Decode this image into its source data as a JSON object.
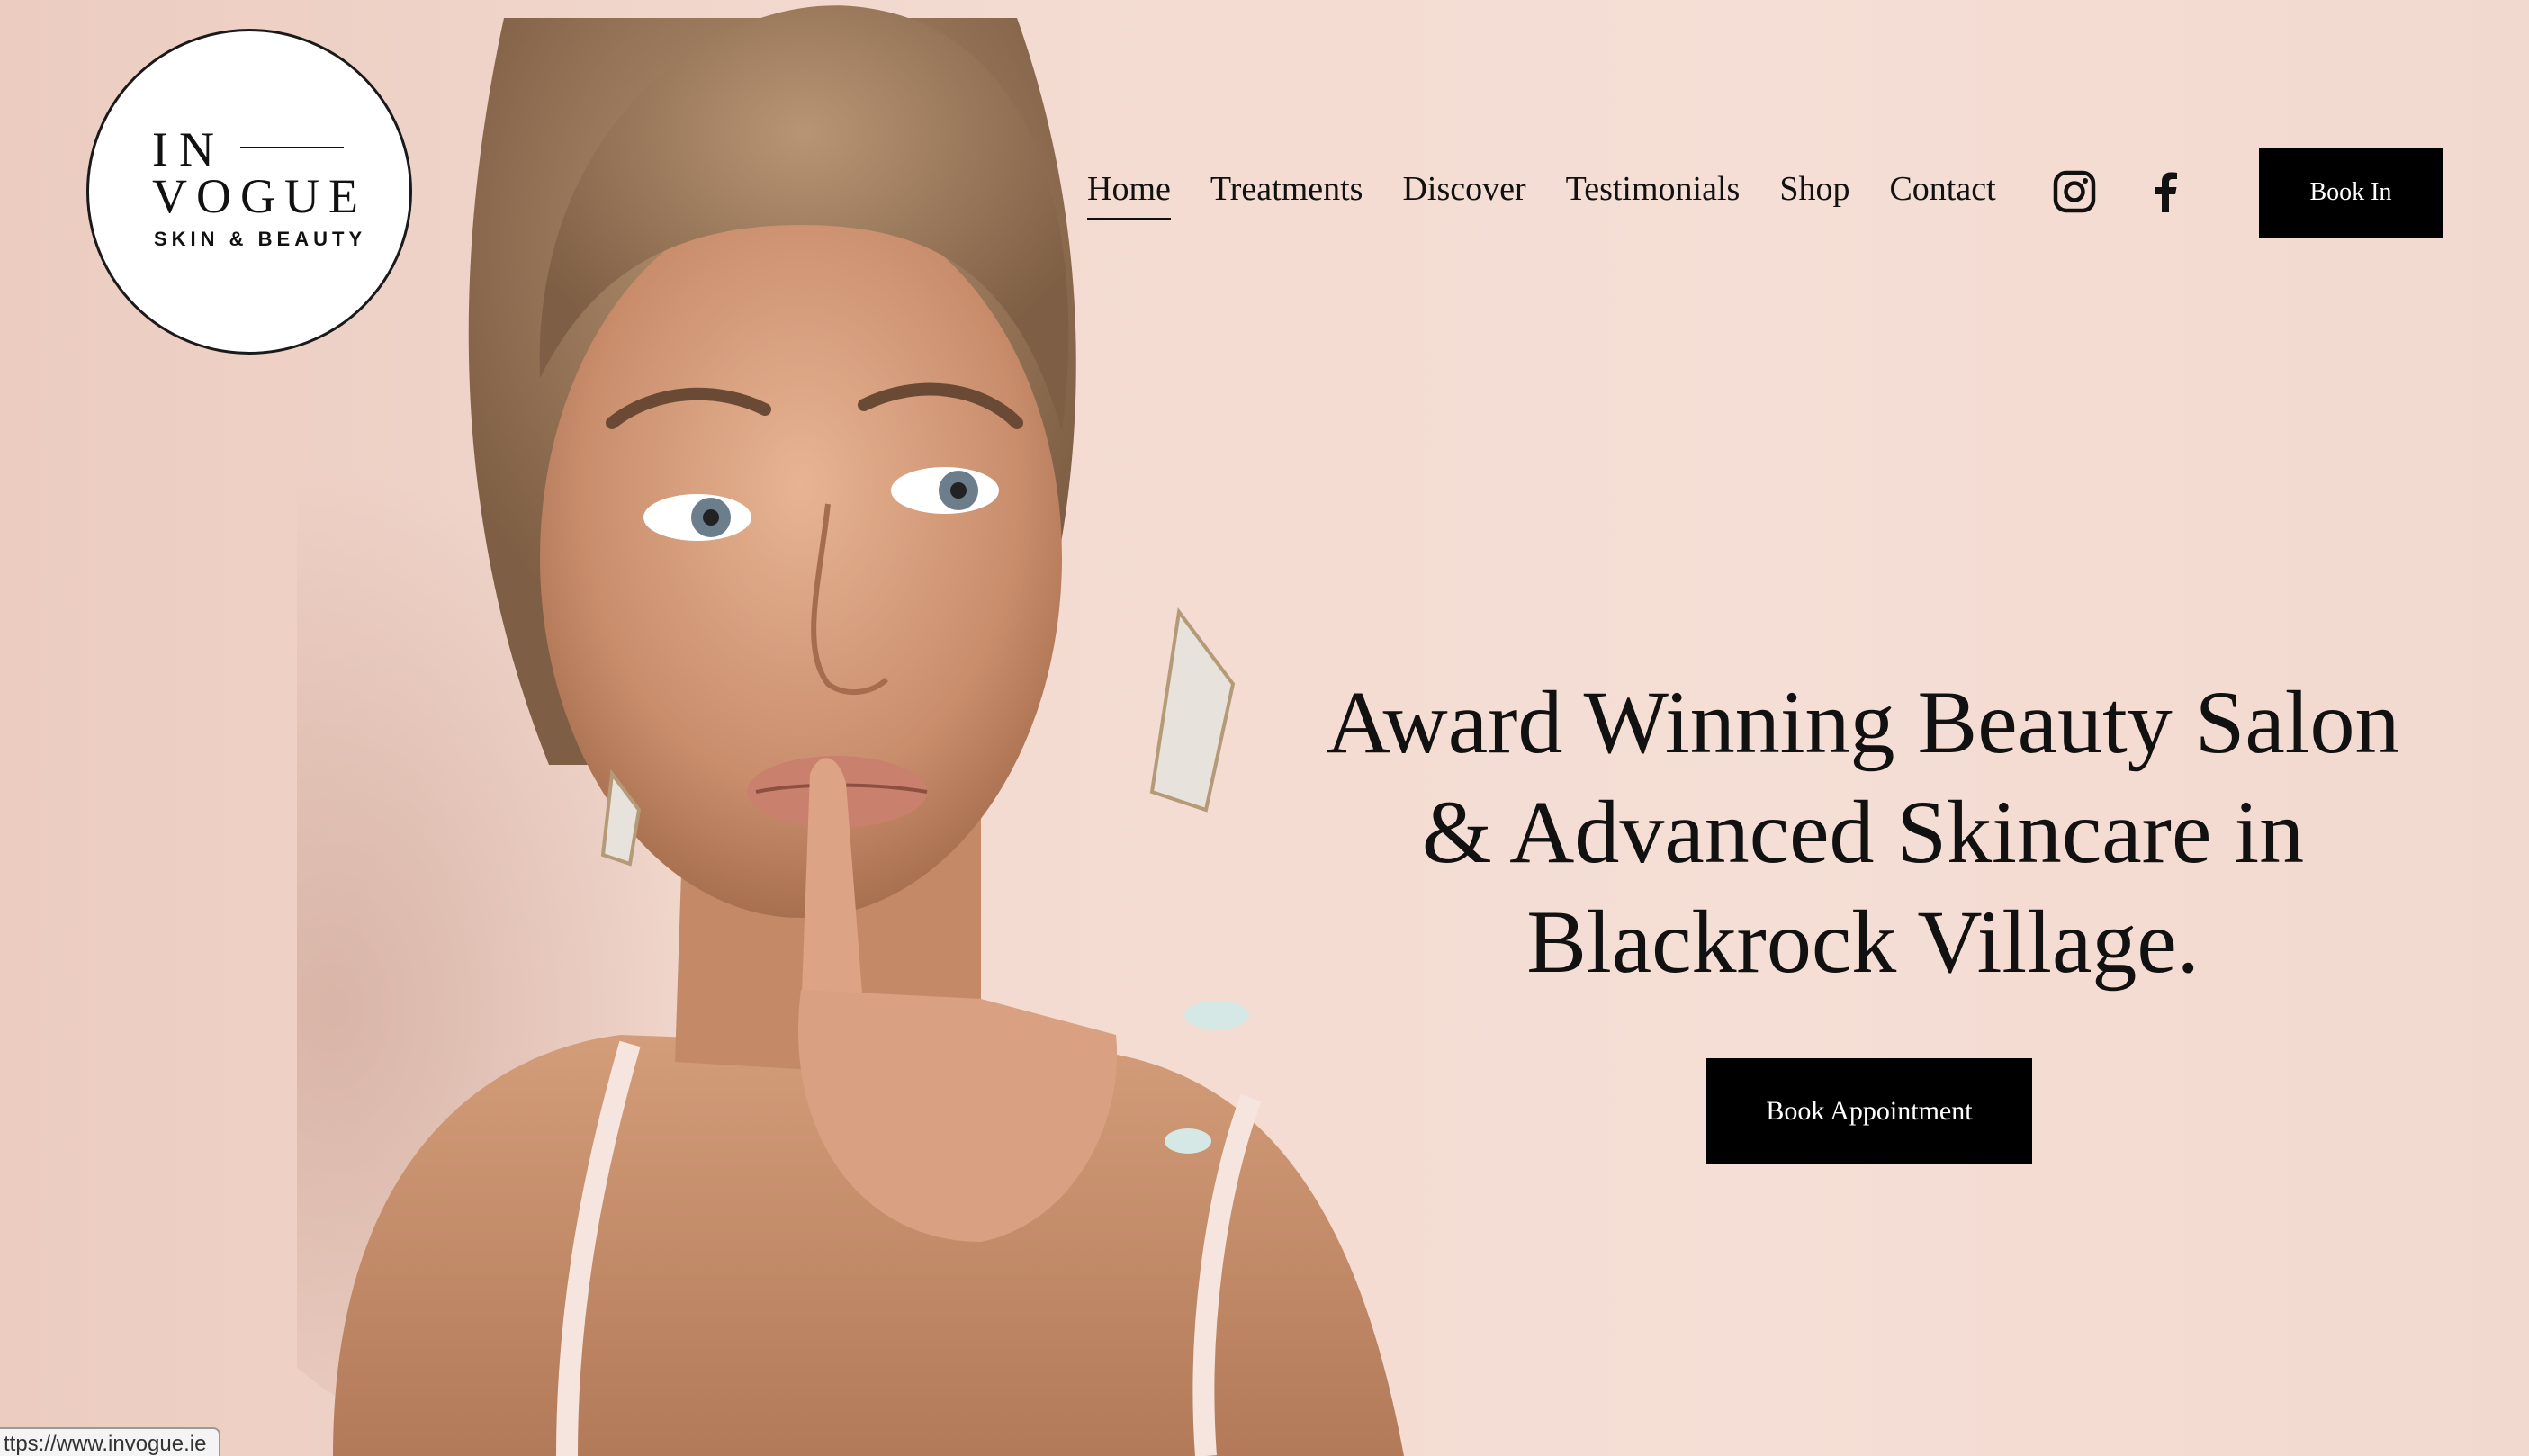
{
  "logo": {
    "line1": "IN",
    "line2": "VOGUE",
    "line3": "SKIN & BEAUTY"
  },
  "nav": {
    "items": [
      "Home",
      "Treatments",
      "Discover",
      "Testimonials",
      "Shop",
      "Contact"
    ],
    "active": "Home"
  },
  "social": {
    "icons": [
      "instagram-icon",
      "facebook-icon"
    ]
  },
  "header": {
    "book_in_label": "Book In"
  },
  "hero": {
    "title_line1": "Award Winning Beauty Salon",
    "title_line2": "& Advanced Skincare in",
    "title_line3": "Blackrock Village.",
    "cta_label": "Book Appointment"
  },
  "status_bar": {
    "url": "ttps://www.invogue.ie"
  },
  "colors": {
    "background": "#f3dbd1",
    "button": "#000000",
    "button_text": "#ffffff",
    "text": "#111111"
  }
}
